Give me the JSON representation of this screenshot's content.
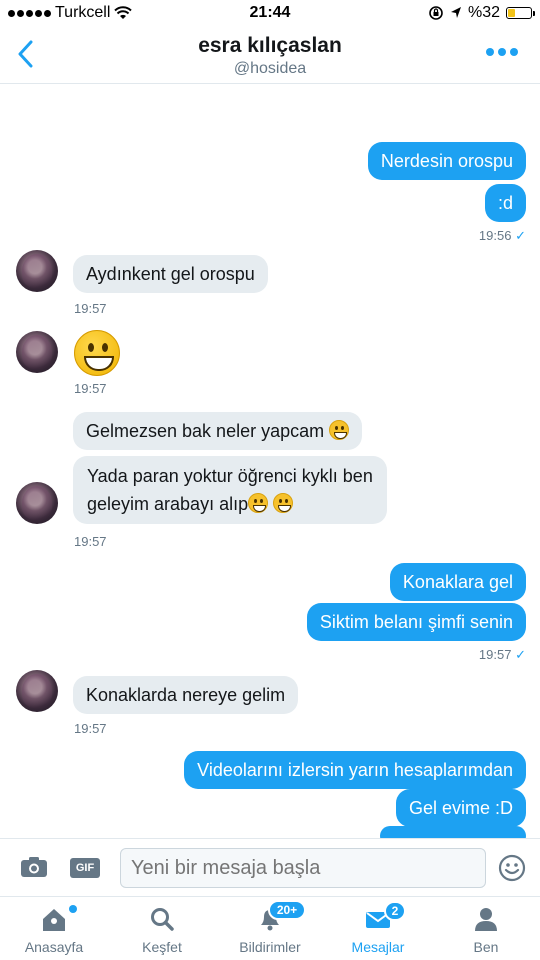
{
  "status_bar": {
    "carrier": "Turkcell",
    "time": "21:44",
    "battery": "%32",
    "battery_level": 0.32
  },
  "header": {
    "name": "esra kılıçaslan",
    "handle": "@hosidea"
  },
  "messages": {
    "m1": "Nerdesin orospu",
    "m2": ":d",
    "t1": "19:56",
    "m3": "Aydınkent gel orospu",
    "t2": "19:57",
    "t3": "19:57",
    "m4": "Gelmezsen bak neler yapcam",
    "m5_line1": "Yada paran yoktur öğrenci kyklı ben",
    "m5_line2": "geleyim arabayı alıp",
    "t4": "19:57",
    "m6": "Konaklara gel",
    "m7": "Siktim belanı şimfi senin",
    "t5": "19:57",
    "m8": "Konaklarda nereye gelim",
    "t6": "19:57",
    "m9": "Videolarını izlersin yarın hesaplarımdan",
    "m10": "Gel evime :D"
  },
  "compose": {
    "placeholder": "Yeni bir mesaja başla",
    "gif_label": "GIF"
  },
  "tabs": [
    {
      "label": "Anasayfa"
    },
    {
      "label": "Keşfet"
    },
    {
      "label": "Bildirimler",
      "badge": "20+"
    },
    {
      "label": "Mesajlar",
      "badge": "2"
    },
    {
      "label": "Ben"
    }
  ],
  "colors": {
    "accent": "#1da1f2",
    "incoming_bubble": "#e6ecf0",
    "battery": "#f2c318"
  }
}
